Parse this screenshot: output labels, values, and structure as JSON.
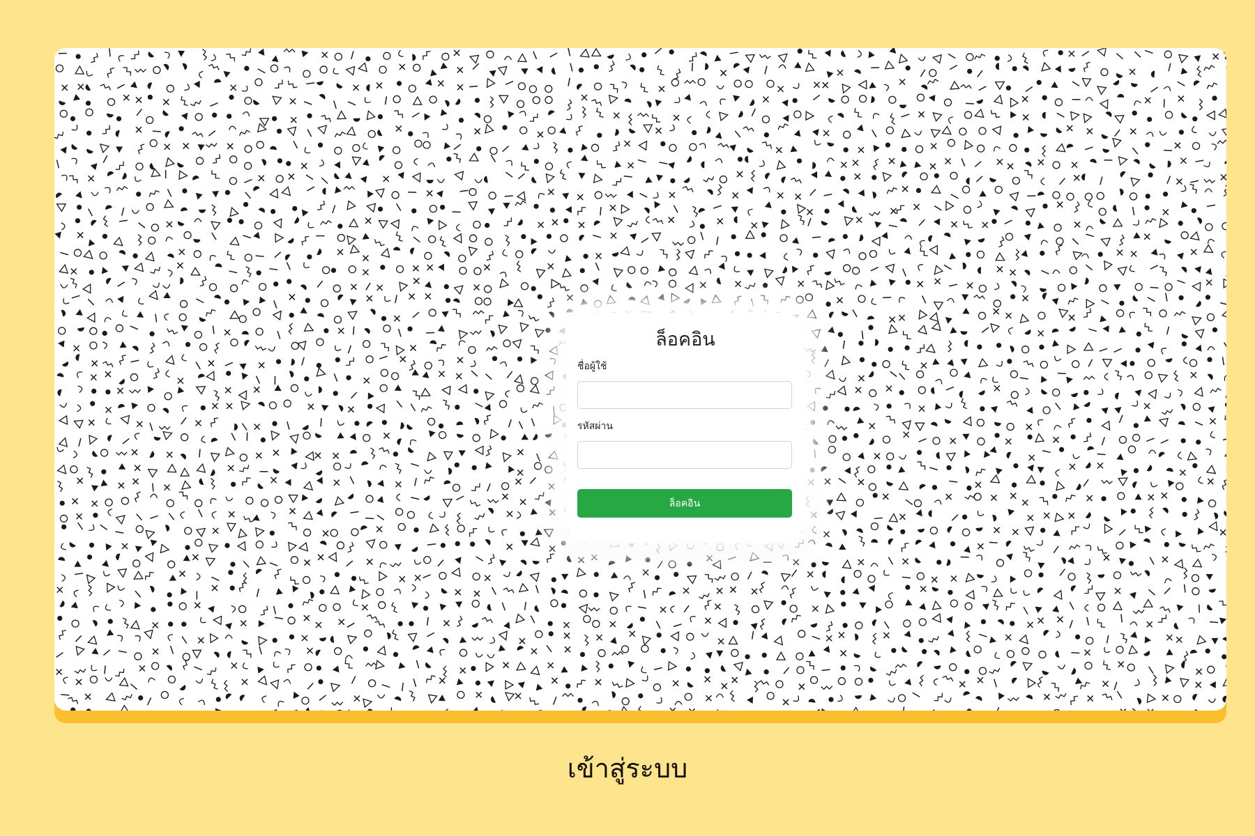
{
  "colors": {
    "page_background": "#fee48c",
    "frame_accent": "#fbbf2d",
    "screen_background": "#ffffff",
    "pattern_ink": "#1a1a1a",
    "button_background": "#28a745",
    "button_text": "#ffffff"
  },
  "background_pattern": {
    "style": "memphis doodle pattern",
    "shapes": [
      "circle",
      "dot",
      "triangle",
      "filled-triangle",
      "cross",
      "line",
      "zigzag",
      "arc",
      "half-circle"
    ]
  },
  "login": {
    "title": "ล็อคอิน",
    "username_label": "ชื่อผู้ใช้",
    "username_value": "",
    "password_label": "รหัสผ่าน",
    "password_value": "",
    "submit_label": "ล็อคอิน"
  },
  "caption": "เข้าสู่ระบบ"
}
